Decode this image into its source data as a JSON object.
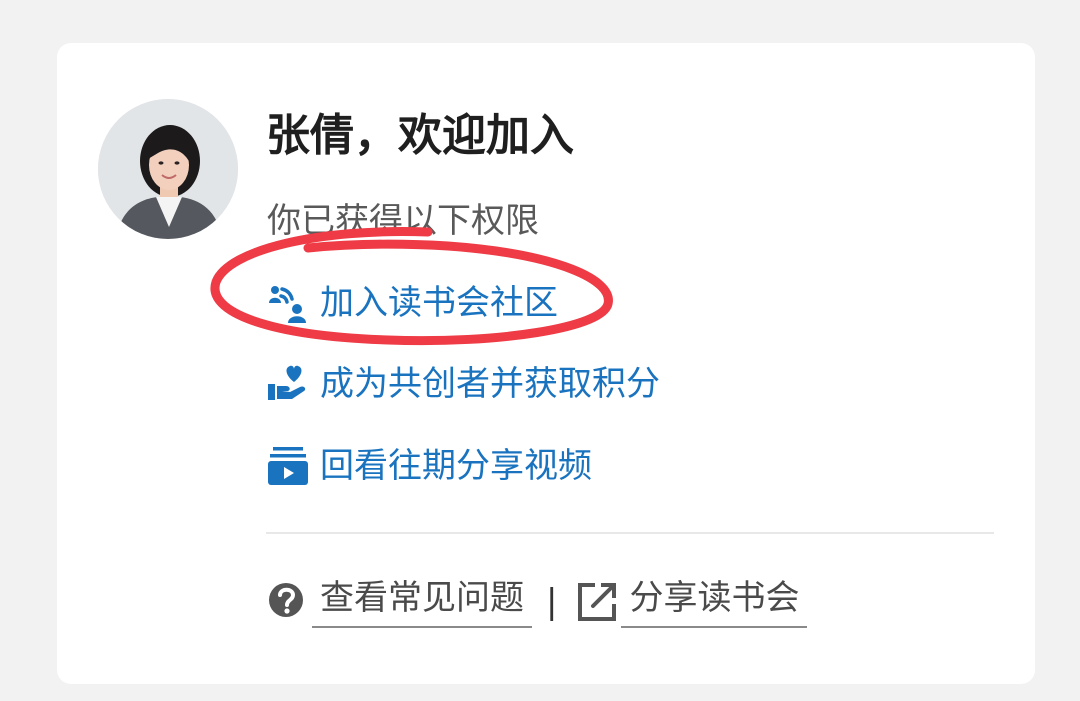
{
  "user": {
    "greeting": "张倩，欢迎加入",
    "avatar_icon": "user-photo-avatar"
  },
  "permissions": {
    "intro": "你已获得以下权限",
    "items": [
      {
        "label": "加入读书会社区",
        "icon": "community-broadcast-icon"
      },
      {
        "label": "成为共创者并获取积分",
        "icon": "hand-heart-icon"
      },
      {
        "label": "回看往期分享视频",
        "icon": "video-playlist-icon"
      }
    ]
  },
  "footer": {
    "faq_label": "查看常见问题",
    "faq_icon": "question-circle-icon",
    "separator": "|",
    "share_label": "分享读书会",
    "share_icon": "share-external-icon"
  },
  "colors": {
    "link_blue": "#1a73bf",
    "highlight_red": "#ee3b45",
    "background": "#f2f2f2",
    "card": "#ffffff"
  }
}
